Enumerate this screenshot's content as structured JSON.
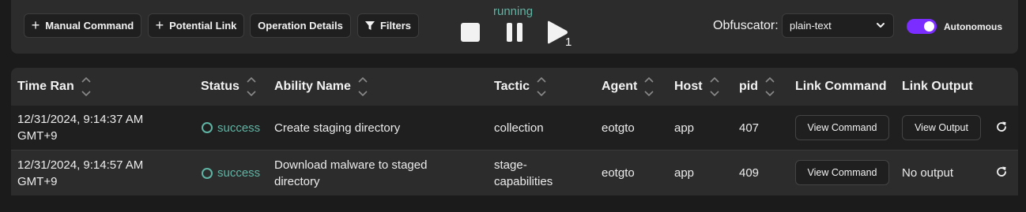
{
  "toolbar": {
    "manual_command": "Manual Command",
    "potential_link": "Potential Link",
    "operation_details": "Operation Details",
    "filters": "Filters",
    "state": "running",
    "play_count": "1",
    "obfuscator_label": "Obfuscator:",
    "obfuscator_value": "plain-text",
    "autonomous_label": "Autonomous",
    "autonomous_on": true,
    "accent_color": "#7b2cff",
    "state_color": "#5fb5a4"
  },
  "table": {
    "headers": {
      "time_ran": "Time Ran",
      "status": "Status",
      "ability_name": "Ability Name",
      "tactic": "Tactic",
      "agent": "Agent",
      "host": "Host",
      "pid": "pid",
      "link_command": "Link Command",
      "link_output": "Link Output"
    },
    "rows": [
      {
        "time_line1": "12/31/2024, 9:14:37 AM",
        "time_line2": "GMT+9",
        "status": "success",
        "ability_line1": "Create staging directory",
        "ability_line2": "",
        "tactic_line1": "collection",
        "tactic_line2": "",
        "agent": "eotgto",
        "host": "app",
        "pid": "407",
        "command_button": "View Command",
        "output_button": "View Output",
        "output_text": ""
      },
      {
        "time_line1": "12/31/2024, 9:14:57 AM",
        "time_line2": "GMT+9",
        "status": "success",
        "ability_line1": "Download malware to staged",
        "ability_line2": "directory",
        "tactic_line1": "stage-",
        "tactic_line2": "capabilities",
        "agent": "eotgto",
        "host": "app",
        "pid": "409",
        "command_button": "View Command",
        "output_button": "",
        "output_text": "No output"
      }
    ]
  }
}
